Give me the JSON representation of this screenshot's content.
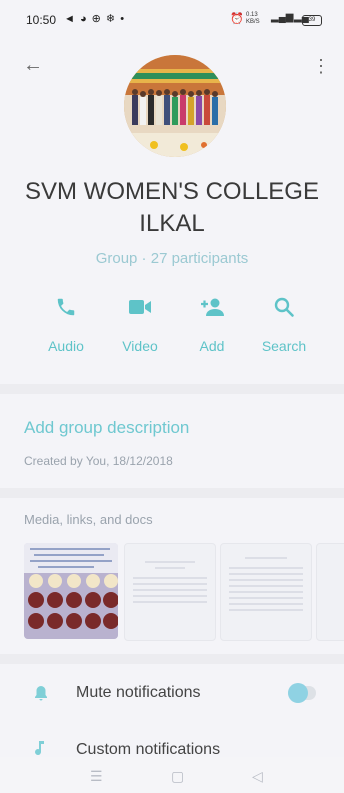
{
  "status_bar": {
    "time": "10:50",
    "left_icons": "◄ ◕ ⊕ ❄ •",
    "right_icons": "⏰",
    "network_text": "0.13 KB/S",
    "battery": "39"
  },
  "header": {
    "back_icon": "←",
    "menu_icon": "⋮"
  },
  "group": {
    "title_line1": "SVM WOMEN'S COLLEGE",
    "title_line2": "ILKAL",
    "subtitle": "Group · 27 participants"
  },
  "actions": [
    {
      "label": "Audio",
      "icon": "phone-icon"
    },
    {
      "label": "Video",
      "icon": "video-icon"
    },
    {
      "label": "Add",
      "icon": "add-person-icon"
    },
    {
      "label": "Search",
      "icon": "search-icon"
    }
  ],
  "description": {
    "link": "Add group description",
    "created": "Created by You, 18/12/2018"
  },
  "media": {
    "title": "Media, links, and docs"
  },
  "settings": {
    "mute_label": "Mute notifications",
    "mute_on": false,
    "custom_label": "Custom notifications"
  },
  "colors": {
    "accent": "#5ec3c8",
    "background": "#f4f4f8"
  }
}
